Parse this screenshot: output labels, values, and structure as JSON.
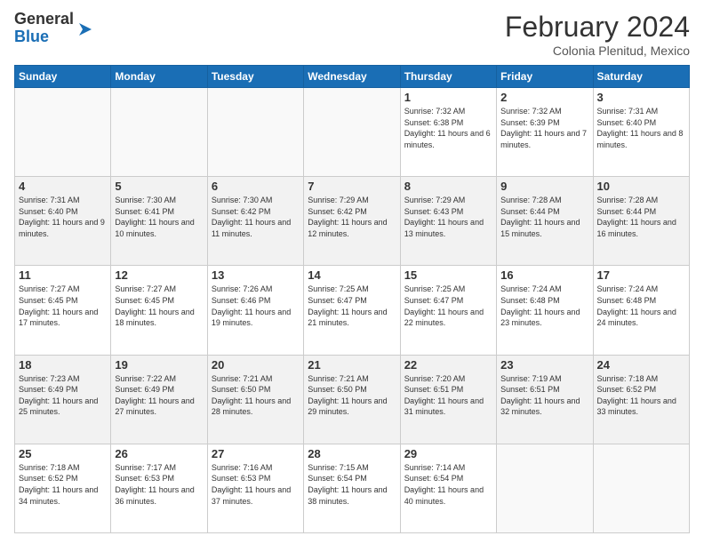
{
  "logo": {
    "general": "General",
    "blue": "Blue"
  },
  "title": "February 2024",
  "location": "Colonia Plenitud, Mexico",
  "days_header": [
    "Sunday",
    "Monday",
    "Tuesday",
    "Wednesday",
    "Thursday",
    "Friday",
    "Saturday"
  ],
  "weeks": [
    [
      {
        "day": "",
        "empty": true
      },
      {
        "day": "",
        "empty": true
      },
      {
        "day": "",
        "empty": true
      },
      {
        "day": "",
        "empty": true
      },
      {
        "day": "1",
        "sunrise": "7:32 AM",
        "sunset": "6:38 PM",
        "daylight": "11 hours and 6 minutes."
      },
      {
        "day": "2",
        "sunrise": "7:32 AM",
        "sunset": "6:39 PM",
        "daylight": "11 hours and 7 minutes."
      },
      {
        "day": "3",
        "sunrise": "7:31 AM",
        "sunset": "6:40 PM",
        "daylight": "11 hours and 8 minutes."
      }
    ],
    [
      {
        "day": "4",
        "sunrise": "7:31 AM",
        "sunset": "6:40 PM",
        "daylight": "11 hours and 9 minutes."
      },
      {
        "day": "5",
        "sunrise": "7:30 AM",
        "sunset": "6:41 PM",
        "daylight": "11 hours and 10 minutes."
      },
      {
        "day": "6",
        "sunrise": "7:30 AM",
        "sunset": "6:42 PM",
        "daylight": "11 hours and 11 minutes."
      },
      {
        "day": "7",
        "sunrise": "7:29 AM",
        "sunset": "6:42 PM",
        "daylight": "11 hours and 12 minutes."
      },
      {
        "day": "8",
        "sunrise": "7:29 AM",
        "sunset": "6:43 PM",
        "daylight": "11 hours and 13 minutes."
      },
      {
        "day": "9",
        "sunrise": "7:28 AM",
        "sunset": "6:44 PM",
        "daylight": "11 hours and 15 minutes."
      },
      {
        "day": "10",
        "sunrise": "7:28 AM",
        "sunset": "6:44 PM",
        "daylight": "11 hours and 16 minutes."
      }
    ],
    [
      {
        "day": "11",
        "sunrise": "7:27 AM",
        "sunset": "6:45 PM",
        "daylight": "11 hours and 17 minutes."
      },
      {
        "day": "12",
        "sunrise": "7:27 AM",
        "sunset": "6:45 PM",
        "daylight": "11 hours and 18 minutes."
      },
      {
        "day": "13",
        "sunrise": "7:26 AM",
        "sunset": "6:46 PM",
        "daylight": "11 hours and 19 minutes."
      },
      {
        "day": "14",
        "sunrise": "7:25 AM",
        "sunset": "6:47 PM",
        "daylight": "11 hours and 21 minutes."
      },
      {
        "day": "15",
        "sunrise": "7:25 AM",
        "sunset": "6:47 PM",
        "daylight": "11 hours and 22 minutes."
      },
      {
        "day": "16",
        "sunrise": "7:24 AM",
        "sunset": "6:48 PM",
        "daylight": "11 hours and 23 minutes."
      },
      {
        "day": "17",
        "sunrise": "7:24 AM",
        "sunset": "6:48 PM",
        "daylight": "11 hours and 24 minutes."
      }
    ],
    [
      {
        "day": "18",
        "sunrise": "7:23 AM",
        "sunset": "6:49 PM",
        "daylight": "11 hours and 25 minutes."
      },
      {
        "day": "19",
        "sunrise": "7:22 AM",
        "sunset": "6:49 PM",
        "daylight": "11 hours and 27 minutes."
      },
      {
        "day": "20",
        "sunrise": "7:21 AM",
        "sunset": "6:50 PM",
        "daylight": "11 hours and 28 minutes."
      },
      {
        "day": "21",
        "sunrise": "7:21 AM",
        "sunset": "6:50 PM",
        "daylight": "11 hours and 29 minutes."
      },
      {
        "day": "22",
        "sunrise": "7:20 AM",
        "sunset": "6:51 PM",
        "daylight": "11 hours and 31 minutes."
      },
      {
        "day": "23",
        "sunrise": "7:19 AM",
        "sunset": "6:51 PM",
        "daylight": "11 hours and 32 minutes."
      },
      {
        "day": "24",
        "sunrise": "7:18 AM",
        "sunset": "6:52 PM",
        "daylight": "11 hours and 33 minutes."
      }
    ],
    [
      {
        "day": "25",
        "sunrise": "7:18 AM",
        "sunset": "6:52 PM",
        "daylight": "11 hours and 34 minutes."
      },
      {
        "day": "26",
        "sunrise": "7:17 AM",
        "sunset": "6:53 PM",
        "daylight": "11 hours and 36 minutes."
      },
      {
        "day": "27",
        "sunrise": "7:16 AM",
        "sunset": "6:53 PM",
        "daylight": "11 hours and 37 minutes."
      },
      {
        "day": "28",
        "sunrise": "7:15 AM",
        "sunset": "6:54 PM",
        "daylight": "11 hours and 38 minutes."
      },
      {
        "day": "29",
        "sunrise": "7:14 AM",
        "sunset": "6:54 PM",
        "daylight": "11 hours and 40 minutes."
      },
      {
        "day": "",
        "empty": true
      },
      {
        "day": "",
        "empty": true
      }
    ]
  ]
}
